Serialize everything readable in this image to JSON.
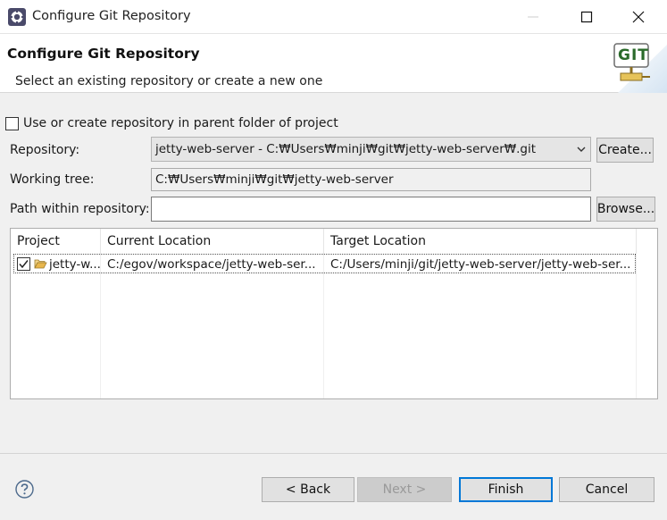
{
  "window": {
    "title": "Configure Git Repository"
  },
  "header": {
    "title": "Configure Git Repository",
    "description": "Select an existing repository or create a new one",
    "logo_text": "GIT"
  },
  "options": {
    "use_parent_label": "Use or create repository in parent folder of project",
    "use_parent_checked": false
  },
  "repository": {
    "label": "Repository:",
    "value": "jetty-web-server - C:₩Users₩minji₩git₩jetty-web-server₩.git",
    "create_button": "Create..."
  },
  "working_tree": {
    "label": "Working tree:",
    "value": "C:₩Users₩minji₩git₩jetty-web-server"
  },
  "path_within": {
    "label": "Path within repository:",
    "value": "",
    "browse_button": "Browse..."
  },
  "table": {
    "columns": [
      "Project",
      "Current Location",
      "Target Location"
    ],
    "rows": [
      {
        "checked": true,
        "project": "jetty-w...",
        "current": "C:/egov/workspace/jetty-web-ser...",
        "target": "C:/Users/minji/git/jetty-web-server/jetty-web-ser..."
      }
    ]
  },
  "footer": {
    "back": "< Back",
    "next": "Next >",
    "finish": "Finish",
    "cancel": "Cancel"
  },
  "colors": {
    "accent": "#0078d7",
    "folder": "#e8b64c"
  }
}
